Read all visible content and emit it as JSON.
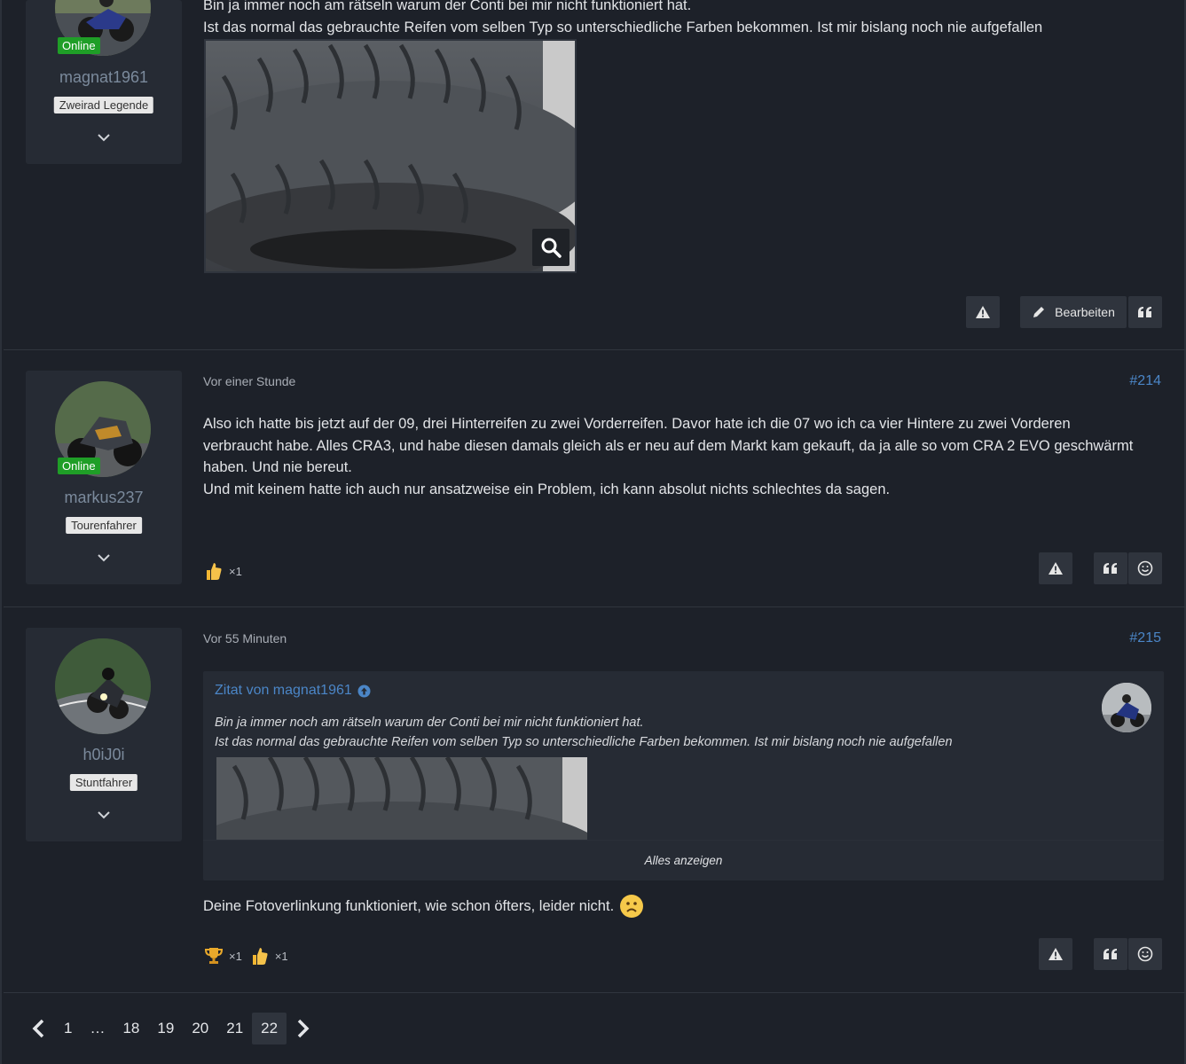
{
  "post1": {
    "username": "magnat1961",
    "status": "Online",
    "rank": "Zweirad Legende",
    "text_line1": "Bin ja immer noch am rätseln warum der Conti bei mir nicht funktioniert hat.",
    "text_line2": "Ist das normal das gebrauchte Reifen vom selben Typ so unterschiedliche Farben bekommen. Ist mir bislang noch nie aufgefallen",
    "edit_label": "Bearbeiten"
  },
  "post2": {
    "username": "markus237",
    "status": "Online",
    "rank": "Tourenfahrer",
    "time": "Vor einer Stunde",
    "number": "#214",
    "text_line1": "Also ich hatte bis jetzt auf der 09, drei Hinterreifen zu zwei Vorderreifen. Davor hate ich die 07 wo ich ca vier Hintere zu zwei Vorderen",
    "text_line2": "verbraucht habe. Alles CRA3, und habe diesen damals gleich als er neu auf dem Markt kam gekauft, da ja alle so vom CRA 2 EVO geschwärmt",
    "text_line3": "haben. Und nie bereut.",
    "text_line4": "Und mit keinem hatte ich auch nur ansatzweise ein Problem, ich kann absolut nichts schlechtes da sagen.",
    "reaction_like_count": "×1"
  },
  "post3": {
    "username": "h0iJ0i",
    "rank": "Stuntfahrer",
    "time": "Vor 55 Minuten",
    "number": "#215",
    "quote_title": "Zitat von magnat1961",
    "quote_line1": "Bin ja immer noch am rätseln warum der Conti bei mir nicht funktioniert hat.",
    "quote_line2": "Ist das normal das gebrauchte Reifen vom selben Typ so unterschiedliche Farben bekommen. Ist mir bislang noch nie aufgefallen",
    "quote_expand": "Alles anzeigen",
    "text": "Deine Fotoverlinkung funktioniert, wie schon öfters, leider nicht.",
    "reaction_trophy_count": "×1",
    "reaction_like_count": "×1"
  },
  "pagination": {
    "pages": [
      "1",
      "…",
      "18",
      "19",
      "20",
      "21",
      "22"
    ],
    "current": "22"
  },
  "colors": {
    "accent": "#4b86c7",
    "online": "#1f9e27",
    "background": "#1d2129",
    "panel": "#262b34"
  }
}
